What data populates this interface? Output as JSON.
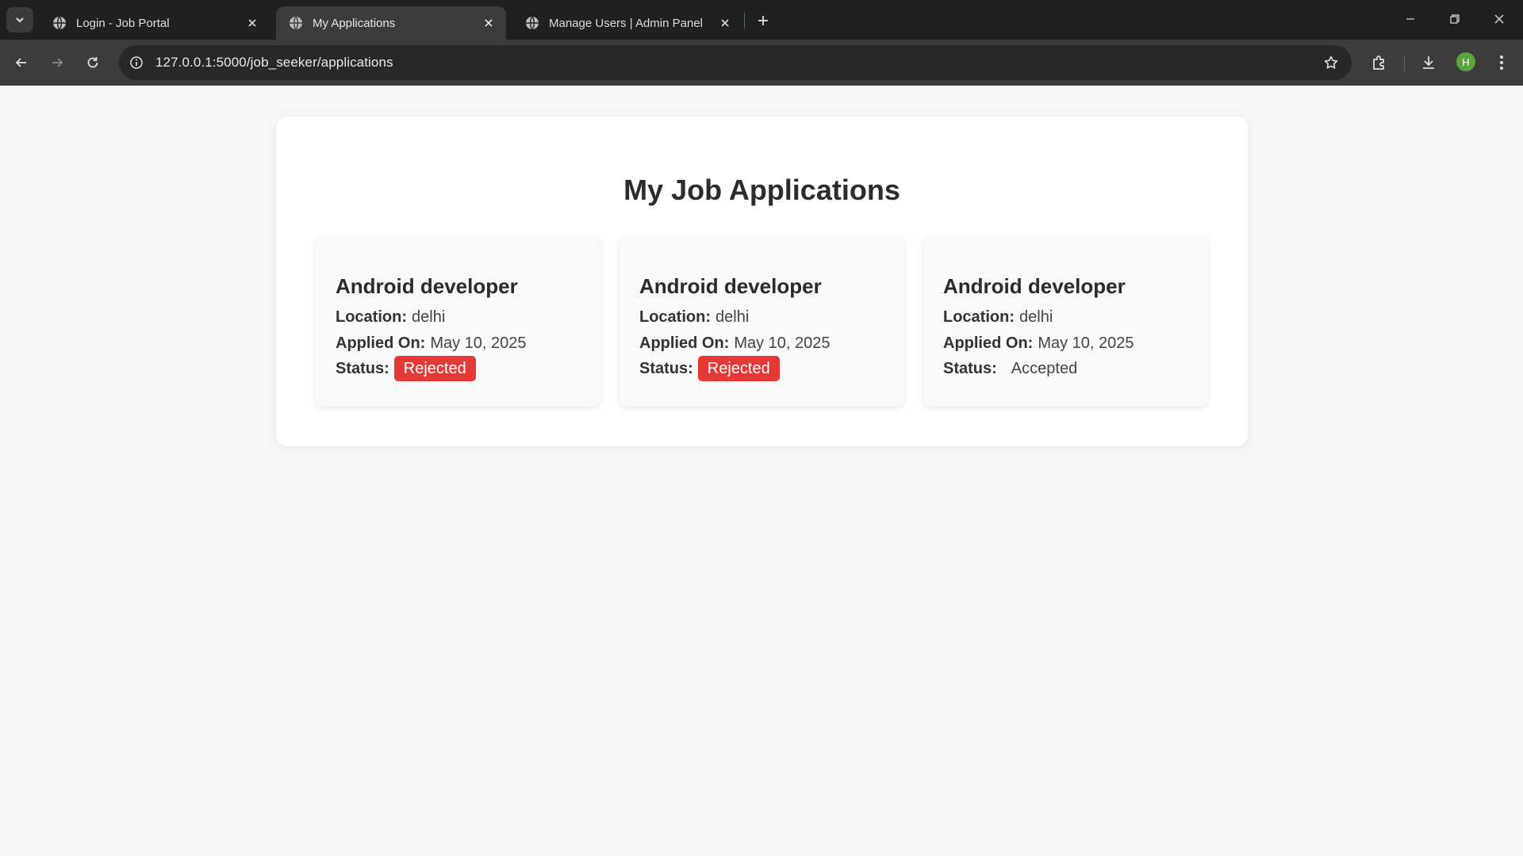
{
  "browser": {
    "tabs": [
      {
        "title": "Login - Job Portal",
        "active": false
      },
      {
        "title": "My Applications",
        "active": true
      },
      {
        "title": "Manage Users | Admin Panel",
        "active": false
      }
    ],
    "url": "127.0.0.1:5000/job_seeker/applications",
    "profile_initial": "H",
    "profile_color": "#5aa43c"
  },
  "page": {
    "title": "My Job Applications",
    "labels": {
      "location": "Location:",
      "applied_on": "Applied On:",
      "status": "Status:"
    },
    "applications": [
      {
        "job_title": "Android developer",
        "location": "delhi",
        "applied_on": "May 10, 2025",
        "status": "Rejected"
      },
      {
        "job_title": "Android developer",
        "location": "delhi",
        "applied_on": "May 10, 2025",
        "status": "Rejected"
      },
      {
        "job_title": "Android developer",
        "location": "delhi",
        "applied_on": "May 10, 2025",
        "status": "Accepted"
      }
    ]
  },
  "colors": {
    "rejected": "#e53935",
    "page_background": "#f7f7f7",
    "chrome_dark": "#1f2020"
  }
}
